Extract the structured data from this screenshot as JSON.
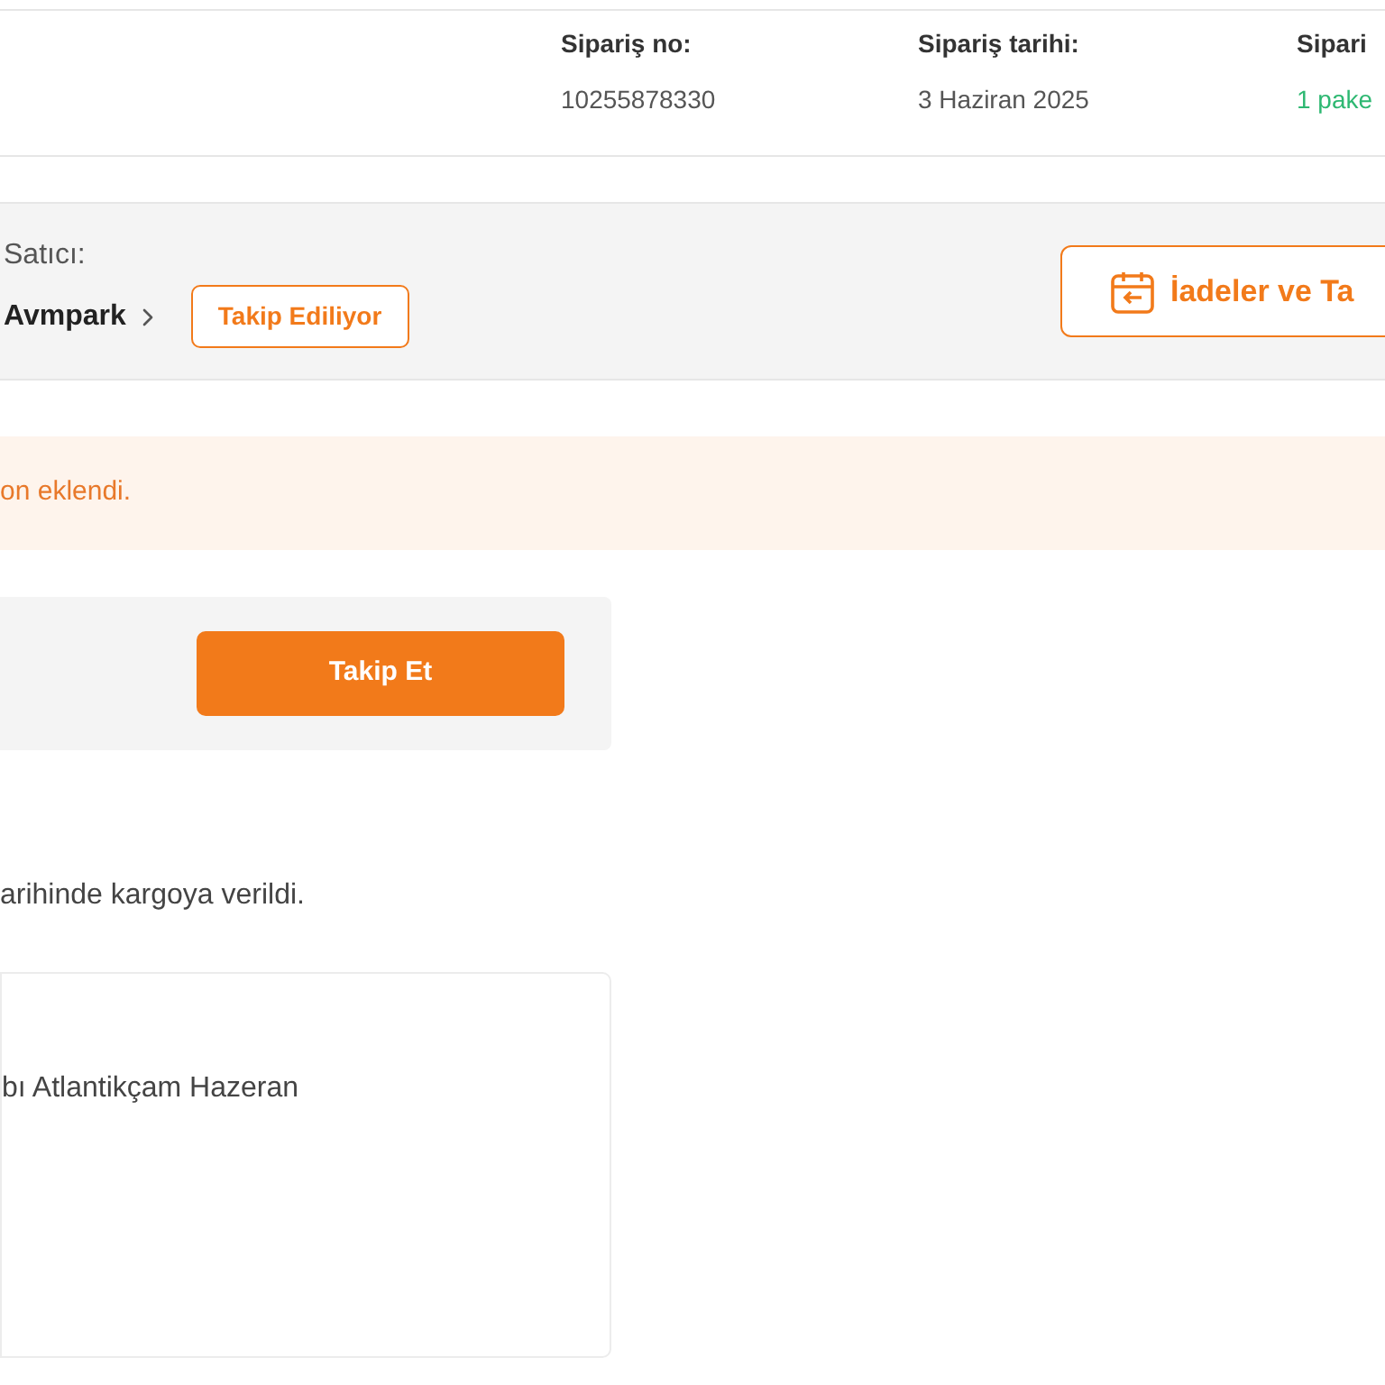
{
  "order_summary": [
    {
      "label": "Sipariş no:",
      "value": "10255878330",
      "kind": "plain"
    },
    {
      "label": "Sipariş tarihi:",
      "value": "3 Haziran 2025",
      "kind": "plain"
    },
    {
      "label": "Sipari",
      "value": "1 pake",
      "kind": "status"
    }
  ],
  "seller": {
    "label": "Satıcı:",
    "name": "Avmpark",
    "follow_badge": "Takip Ediliyor",
    "returns_button": "İadeler ve Ta"
  },
  "alert": "on eklendi.",
  "tracking": {
    "button": "Takip Et"
  },
  "shipment_text": "arihinde kargoya verildi.",
  "product": {
    "title": "bı Atlantikçam Hazeran"
  }
}
